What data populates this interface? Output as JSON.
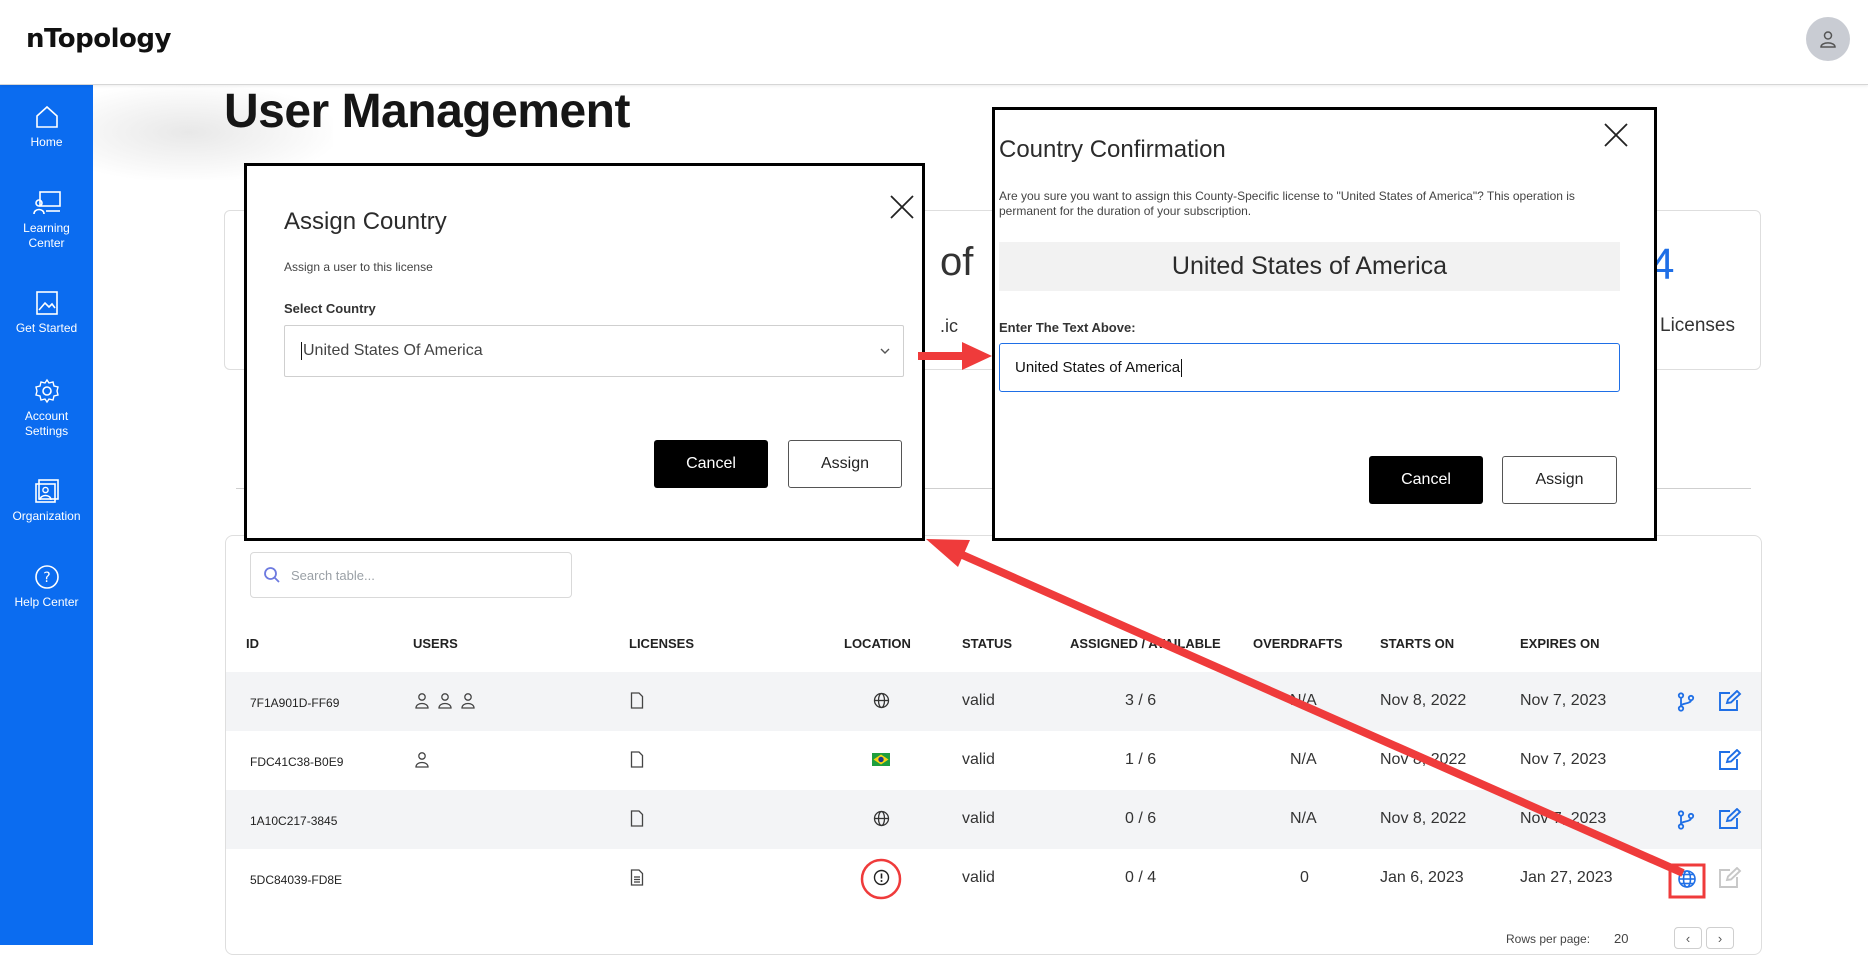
{
  "app": {
    "logo": "nTopology"
  },
  "sidebar": {
    "items": [
      {
        "label": "Home",
        "icon": "home-icon"
      },
      {
        "label": "Learning Center",
        "icon": "learning-center-icon"
      },
      {
        "label": "Get Started",
        "icon": "image-icon"
      },
      {
        "label": "Account Settings",
        "icon": "gear-icon"
      },
      {
        "label": "Organization",
        "icon": "organization-icon"
      },
      {
        "label": "Help Center",
        "icon": "help-icon"
      }
    ]
  },
  "page": {
    "title": "User Management",
    "stat_fragments": {
      "a": "of",
      "b": ".ic",
      "c": "4",
      "d": "Licenses"
    }
  },
  "table": {
    "search_placeholder": "Search table...",
    "headers": [
      "ID",
      "USERS",
      "LICENSES",
      "LOCATION",
      "STATUS",
      "ASSIGNED / AVAILABLE",
      "OVERDRAFTS",
      "STARTS ON",
      "EXPIRES ON"
    ],
    "rows": [
      {
        "id": "7F1A901D-FF69",
        "users": 3,
        "location": "globe",
        "status": "valid",
        "assigned": "3 / 6",
        "overdrafts": "N/A",
        "starts": "Nov 8, 2022",
        "expires": "Nov 7, 2023",
        "branch": true,
        "edit_enabled": true
      },
      {
        "id": "FDC41C38-B0E9",
        "users": 1,
        "location": "brazil-flag",
        "status": "valid",
        "assigned": "1 / 6",
        "overdrafts": "N/A",
        "starts": "Nov 8, 2022",
        "expires": "Nov 7, 2023",
        "branch": false,
        "edit_enabled": true
      },
      {
        "id": "1A10C217-3845",
        "users": 0,
        "location": "globe",
        "status": "valid",
        "assigned": "0 / 6",
        "overdrafts": "N/A",
        "starts": "Nov 8, 2022",
        "expires": "Nov 7, 2023",
        "branch": true,
        "edit_enabled": true
      },
      {
        "id": "5DC84039-FD8E",
        "users": 0,
        "location": "alert",
        "status": "valid",
        "assigned": "0 / 4",
        "overdrafts": "0",
        "starts": "Jan 6, 2023",
        "expires": "Jan 27, 2023",
        "branch": false,
        "edit_enabled": false
      }
    ],
    "rows_per_page_label": "Rows per page:",
    "rows_per_page_value": "20"
  },
  "assign_dialog": {
    "title": "Assign Country",
    "subtitle": "Assign a user to this license",
    "select_label": "Select Country",
    "select_value": "United States Of America",
    "cancel": "Cancel",
    "assign": "Assign"
  },
  "confirm_dialog": {
    "title": "Country Confirmation",
    "message": "Are you sure you want to assign this County-Specific license to \"United States of America\"? This operation is permanent for the duration of your subscription.",
    "country_display": "United States of America",
    "input_label": "Enter The Text Above:",
    "input_value": "United States of America",
    "cancel": "Cancel",
    "assign": "Assign"
  },
  "colors": {
    "sidebar": "#0b6cf0",
    "accent": "#1f6fe6",
    "annotation": "#ef3b3b"
  }
}
